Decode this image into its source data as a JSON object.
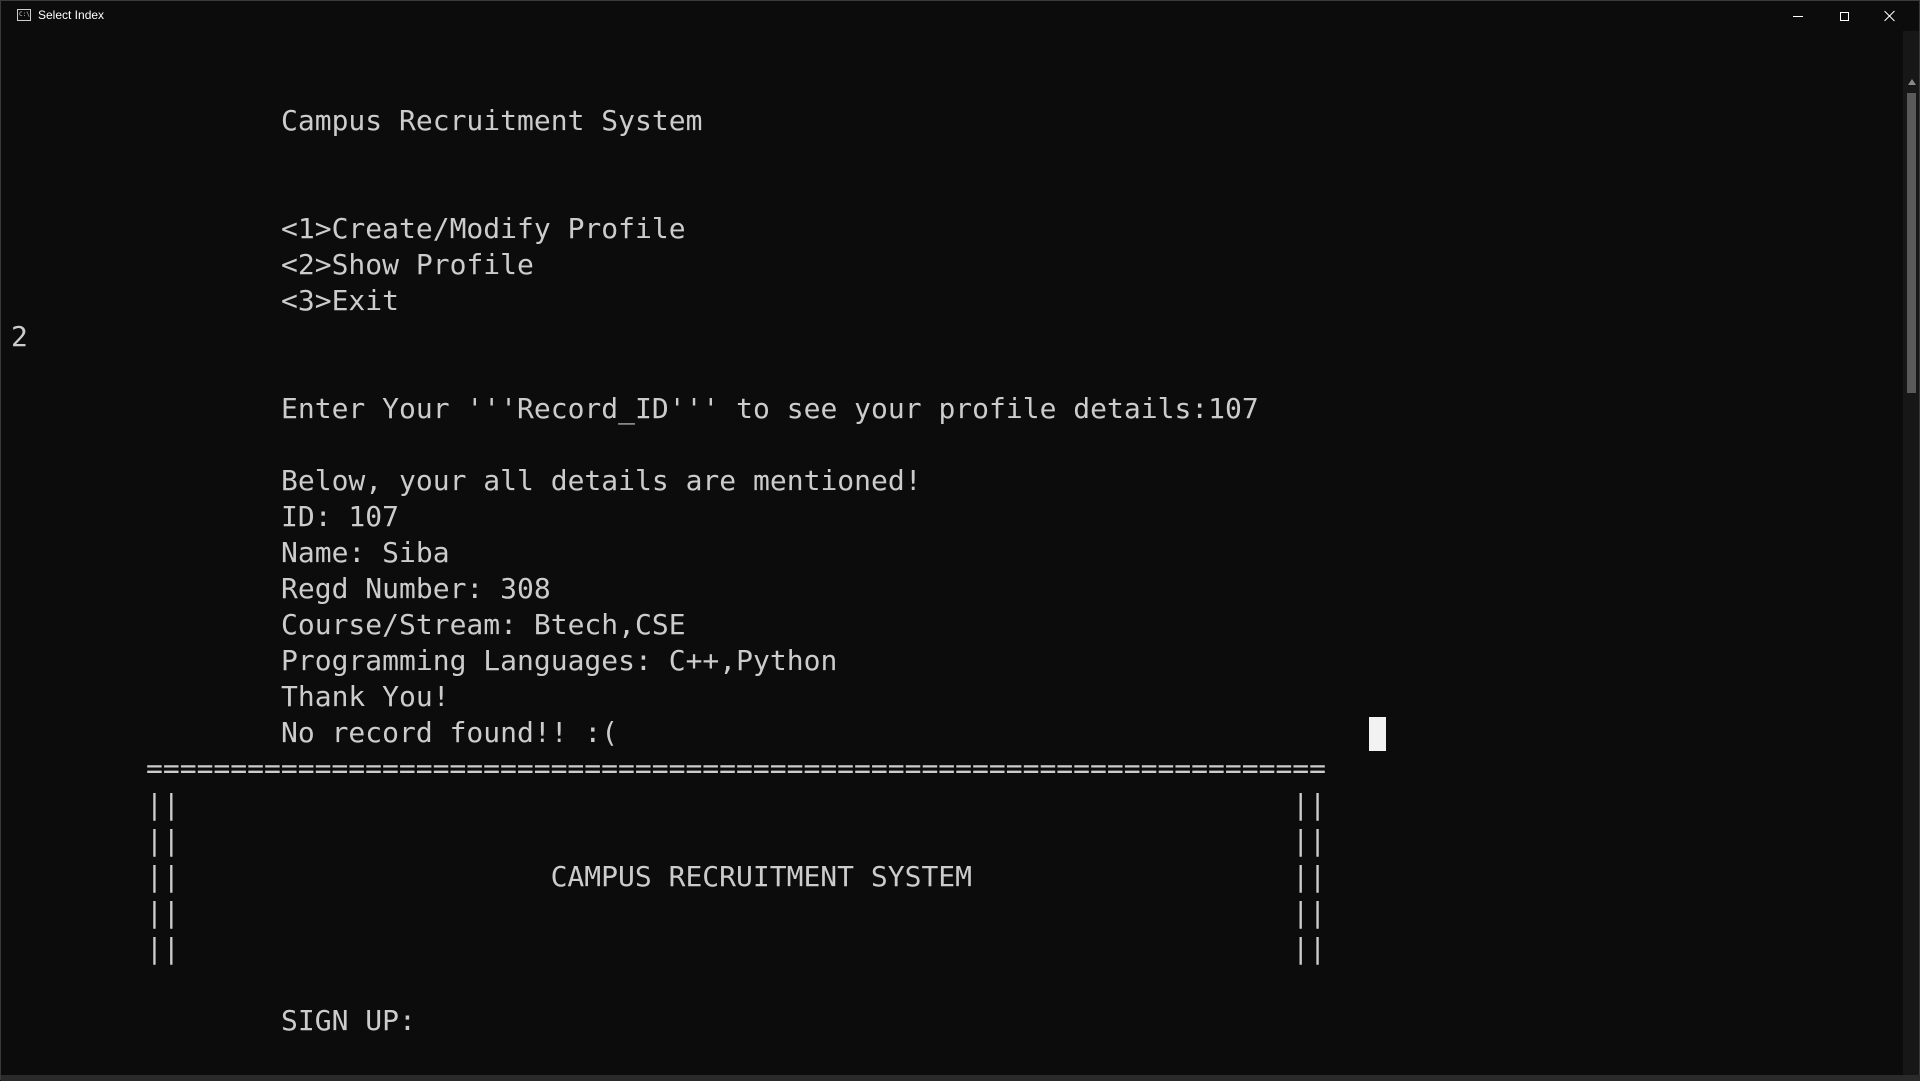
{
  "window": {
    "title": "Select Index",
    "icon": "console-icon",
    "buttons": [
      "minimize-icon",
      "maximize-icon",
      "close-icon"
    ]
  },
  "console": {
    "lines": [
      "Campus Recruitment System",
      "<1>Create/Modify Profile",
      "<2>Show Profile",
      "<3>Exit",
      "2",
      "Enter Your '''Record_ID''' to see your profile details:107",
      "Below, your all details are mentioned!",
      "ID: 107",
      "Name: Siba",
      "Regd Number: 308",
      "Course/Stream: Btech,CSE",
      "Programming Languages: C++,Python",
      "Thank You!",
      "No record found!! :(",
      "======================================================================",
      "||                                                                  ||",
      "||                                                                  ||",
      "||                      CAMPUS RECRUITMENT SYSTEM                   ||",
      "||                                                                  ||",
      "||                                                                  ||",
      "SIGN UP:"
    ]
  },
  "colors": {
    "background": "#0c0c0c",
    "text": "#cccccc",
    "cursor": "#f2f2f2"
  }
}
